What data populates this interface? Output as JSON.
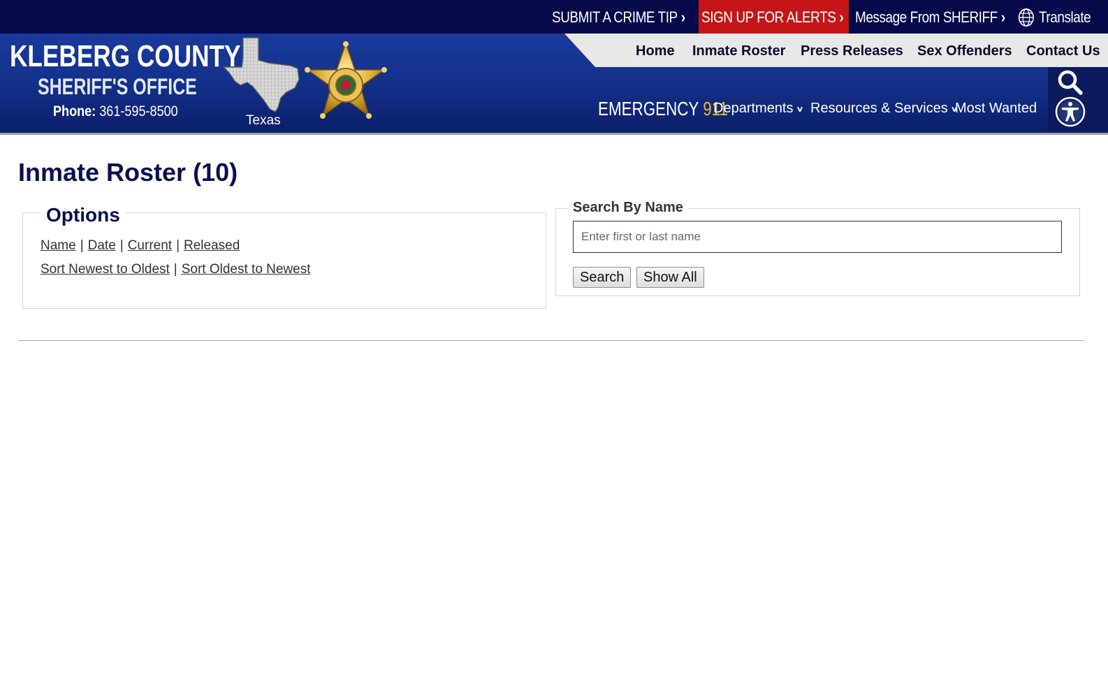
{
  "topbar": {
    "crime_tip": "SUBMIT A CRIME TIP",
    "alerts": "SIGN UP FOR ALERTS",
    "message": "Message From SHERIFF",
    "translate": "Translate"
  },
  "brand": {
    "line1": "KLEBERG COUNTY",
    "line2": "SHERIFF'S OFFICE",
    "phone_label": "Phone:",
    "phone_number": "361-595-8500",
    "map_label": "Texas"
  },
  "main_nav": [
    "Home",
    "Inmate Roster",
    "Press Releases",
    "Sex Offenders",
    "Contact Us"
  ],
  "emergency": {
    "label": "EMERGENCY",
    "number": "911"
  },
  "sub_nav": [
    "Departments",
    "Resources & Services",
    "Most Wanted"
  ],
  "page": {
    "title": "Inmate Roster (10)"
  },
  "options": {
    "legend": "Options",
    "row1": [
      "Name",
      "Date",
      "Current",
      "Released"
    ],
    "row2": [
      "Sort Newest to Oldest",
      "Sort Oldest to Newest"
    ],
    "separator": "|"
  },
  "search": {
    "legend": "Search By Name",
    "placeholder": "Enter first or last name",
    "search_button": "Search",
    "show_all_button": "Show All"
  },
  "colors": {
    "topbar": "#05094a",
    "alerts": "#c41617",
    "header_blue": "#14328c",
    "accent_gold": "#f3b71a",
    "heading": "#0a0f4e"
  },
  "icons": [
    "chevron-right-icon",
    "globe-icon",
    "chevron-down-icon",
    "search-icon",
    "accessibility-icon"
  ]
}
